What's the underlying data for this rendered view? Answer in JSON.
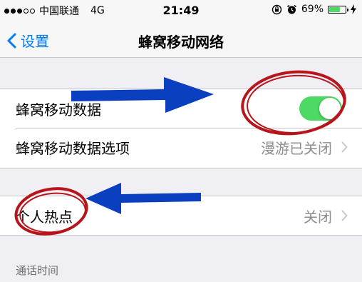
{
  "status_bar": {
    "carrier": "中国联通",
    "network": "4G",
    "time": "21:49",
    "battery_percent": "69%",
    "battery_level": 0.69
  },
  "nav": {
    "back_label": "设置",
    "title": "蜂窝移动网络"
  },
  "settings": {
    "cellular_data": {
      "label": "蜂窝移动数据",
      "enabled": true
    },
    "cellular_data_options": {
      "label": "蜂窝移动数据选项",
      "value": "漫游已关闭"
    },
    "personal_hotspot": {
      "label": "个人热点",
      "value": "关闭"
    },
    "call_time_header": "通话时间"
  },
  "colors": {
    "accent": "#007aff",
    "toggle_on": "#4cd964",
    "annotation_arrow": "#0a3fbf",
    "annotation_circle": "#b8141b"
  }
}
